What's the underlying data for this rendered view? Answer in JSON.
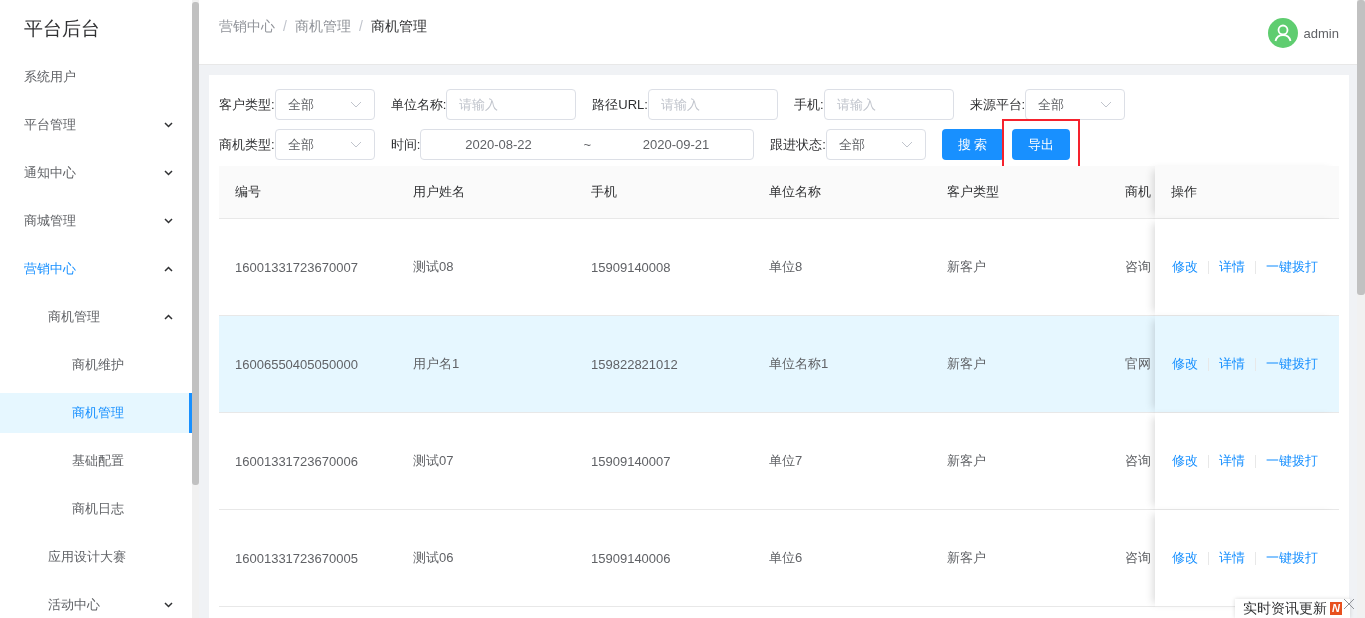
{
  "sidebar": {
    "title": "平台后台",
    "items": [
      {
        "label": "系统用户",
        "selected": false
      },
      {
        "label": "平台管理",
        "selected": false,
        "expanded": false
      },
      {
        "label": "通知中心",
        "selected": false,
        "expanded": false
      },
      {
        "label": "商城管理",
        "selected": false,
        "expanded": false
      },
      {
        "label": "营销中心",
        "selected": false,
        "expanded": true,
        "children": [
          {
            "label": "商机管理",
            "selected": false,
            "expanded": true,
            "children": [
              {
                "label": "商机维护",
                "selected": false
              },
              {
                "label": "商机管理",
                "selected": true
              },
              {
                "label": "基础配置",
                "selected": false
              },
              {
                "label": "商机日志",
                "selected": false
              }
            ]
          },
          {
            "label": "应用设计大赛",
            "selected": false
          },
          {
            "label": "活动中心",
            "selected": false,
            "expanded": false
          }
        ]
      }
    ]
  },
  "breadcrumb": {
    "separator": "/",
    "items": [
      "营销中心",
      "商机管理",
      "商机管理"
    ]
  },
  "user": {
    "name": "admin"
  },
  "filters": [
    {
      "kind": "select",
      "label": "客户类型:",
      "value": "全部"
    },
    {
      "kind": "input",
      "label": "单位名称:",
      "placeholder": "请输入"
    },
    {
      "kind": "input",
      "label": "路径URL:",
      "placeholder": "请输入"
    },
    {
      "kind": "input",
      "label": "手机:",
      "placeholder": "请输入"
    },
    {
      "kind": "select",
      "label": "来源平台:",
      "value": "全部"
    },
    {
      "kind": "select",
      "label": "商机类型:",
      "value": "全部"
    },
    {
      "kind": "daterange",
      "label": "时间:",
      "start": "2020-08-22",
      "separator": "~",
      "end": "2020-09-21"
    },
    {
      "kind": "select",
      "label": "跟进状态:",
      "value": "全部"
    }
  ],
  "buttons": [
    {
      "label": "搜 索",
      "highlighted": false
    },
    {
      "label": "导出",
      "highlighted": true
    }
  ],
  "table": {
    "columns": [
      "编号",
      "用户姓名",
      "手机",
      "单位名称",
      "客户类型",
      "商机"
    ],
    "action_column": "操作",
    "rows": [
      {
        "selected": false,
        "cells": [
          "16001331723670007",
          "测试08",
          "15909140008",
          "单位8",
          "新客户",
          "咨询"
        ],
        "actions": [
          "修改",
          "详情",
          "一键拨打"
        ]
      },
      {
        "selected": true,
        "cells": [
          "16006550405050000",
          "用户名1",
          "159822821012",
          "单位名称1",
          "新客户",
          "官网"
        ],
        "actions": [
          "修改",
          "详情",
          "一键拨打"
        ]
      },
      {
        "selected": false,
        "cells": [
          "16001331723670006",
          "测试07",
          "15909140007",
          "单位7",
          "新客户",
          "咨询"
        ],
        "actions": [
          "修改",
          "详情",
          "一键拨打"
        ]
      },
      {
        "selected": false,
        "cells": [
          "16001331723670005",
          "测试06",
          "15909140006",
          "单位6",
          "新客户",
          "咨询"
        ],
        "actions": [
          "修改",
          "详情",
          "一键拨打"
        ]
      }
    ]
  },
  "notice": {
    "text": "实时资讯更新",
    "badge": "N"
  }
}
